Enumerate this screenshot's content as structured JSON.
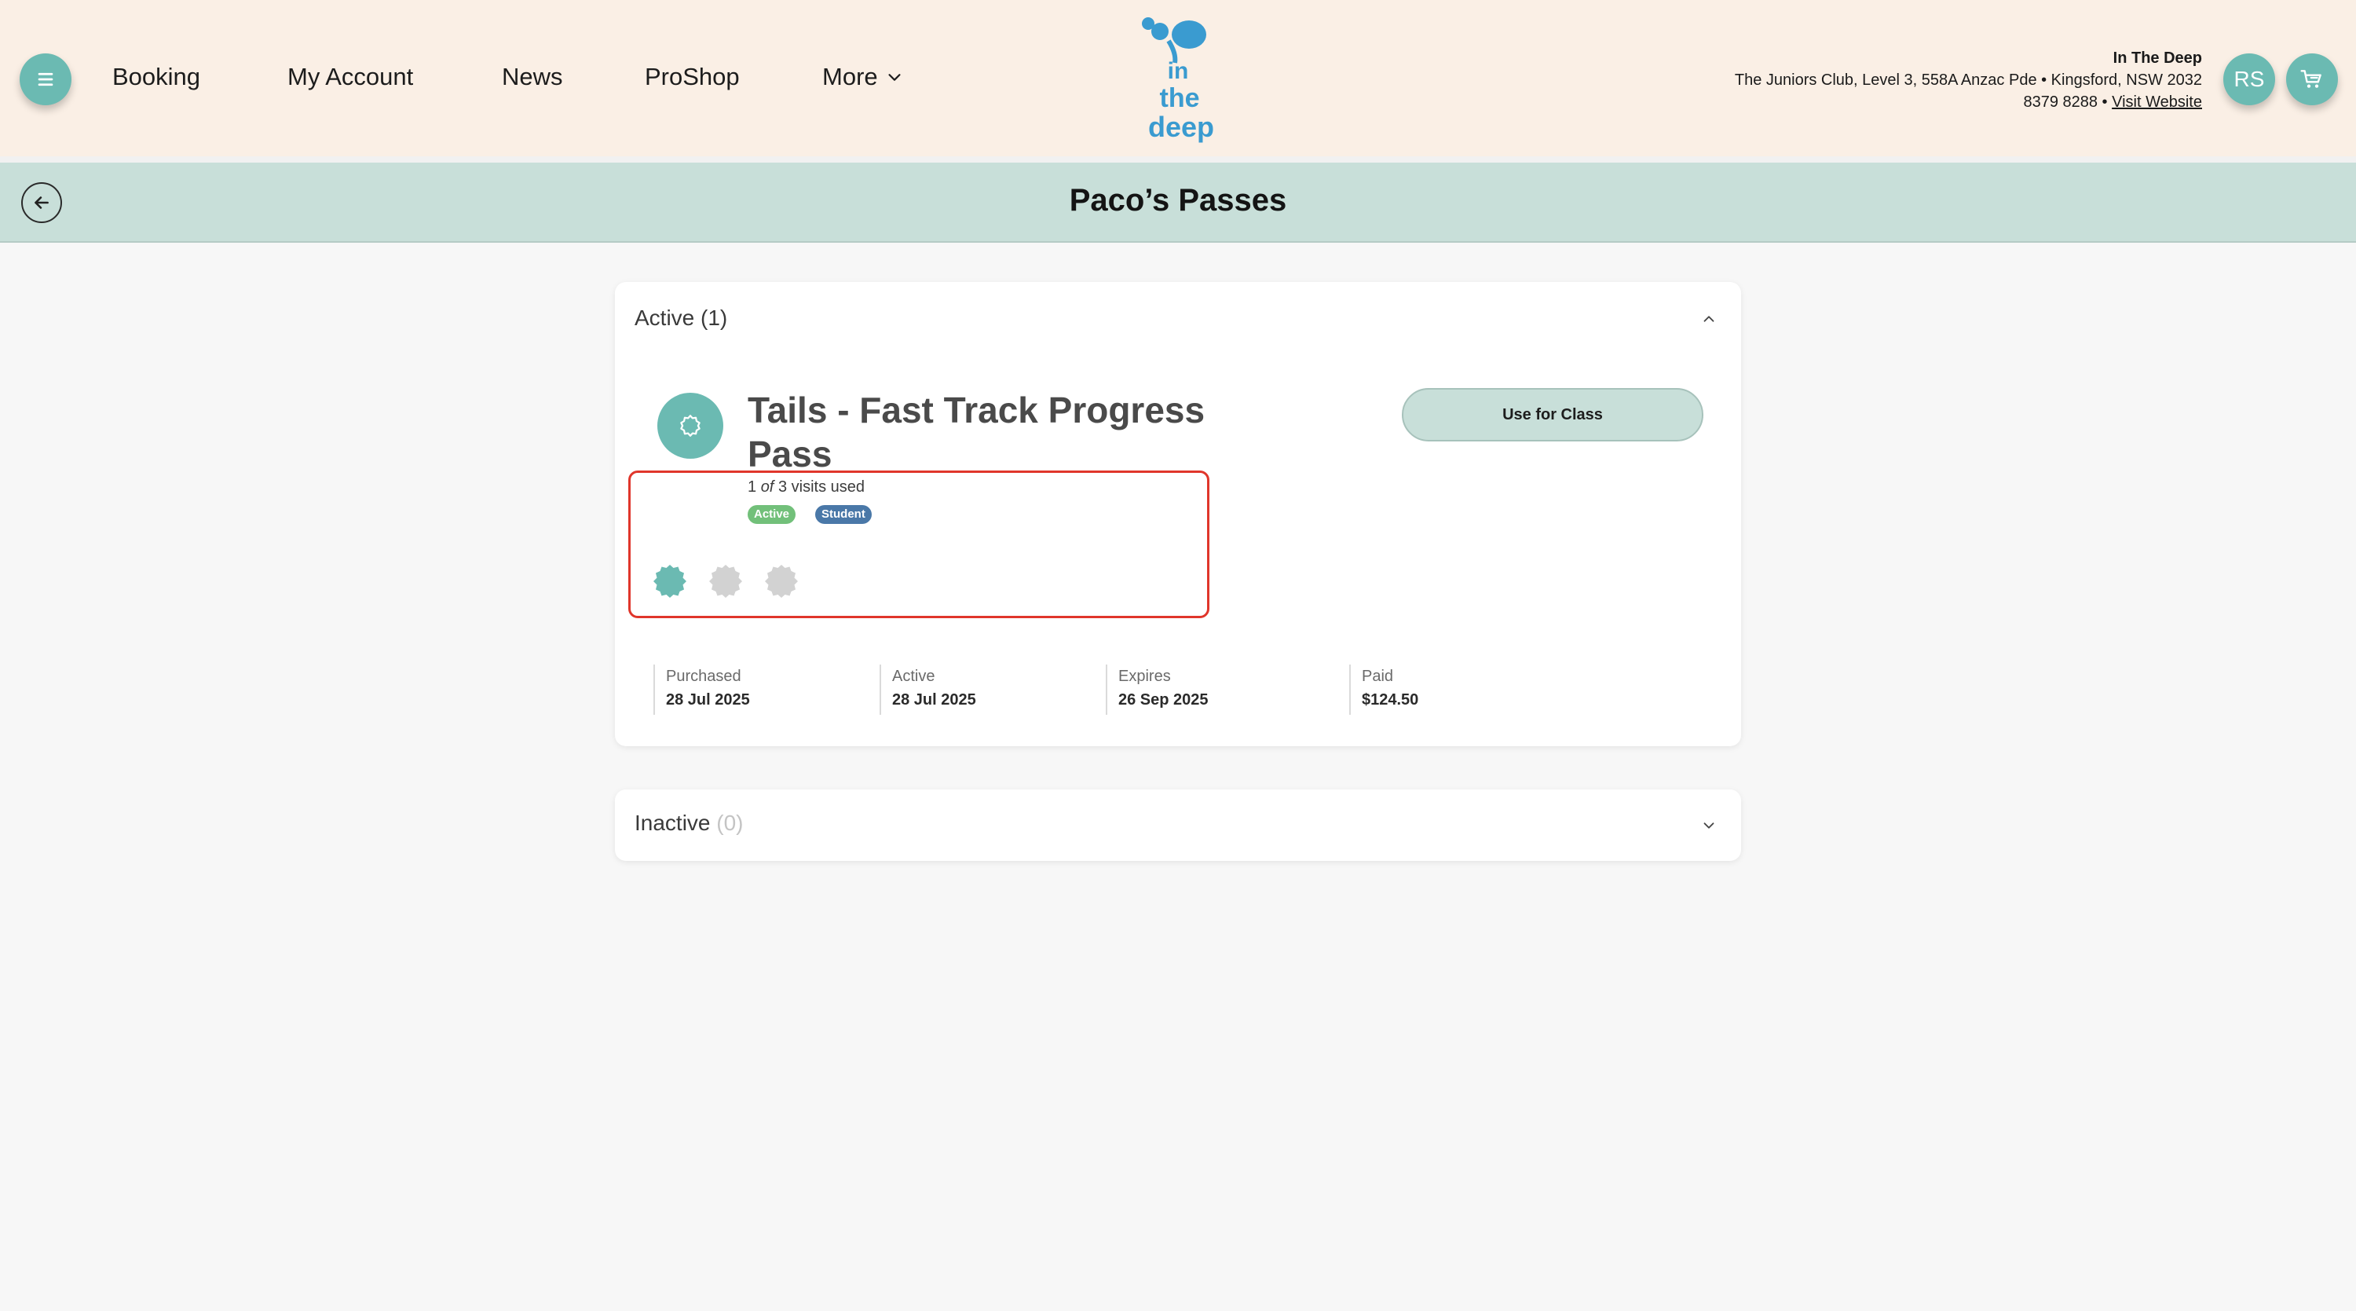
{
  "header": {
    "nav": [
      "Booking",
      "My Account",
      "News",
      "ProShop",
      "More"
    ],
    "logo_text": [
      "in",
      "the",
      "deep"
    ],
    "club": {
      "name": "In The Deep",
      "address": "The Juniors Club, Level 3, 558A Anzac Pde • Kingsford, NSW 2032",
      "phone": "8379 8288 •",
      "website_link": "Visit Website"
    },
    "avatar_initials": "RS"
  },
  "page": {
    "title": "Paco’s Passes"
  },
  "active_section": {
    "label": "Active",
    "count": "(1)",
    "pass": {
      "title": "Tails - Fast Track Progress Pass",
      "visits_used": "1",
      "visits_of": "of",
      "visits_total": "3",
      "visits_suffix": "visits used",
      "badges": [
        "Active",
        "Student"
      ],
      "visit_dots_filled": 1,
      "visit_dots_total": 3,
      "use_button": "Use for Class",
      "details": [
        {
          "label": "Purchased",
          "value": "28 Jul 2025"
        },
        {
          "label": "Active",
          "value": "28 Jul 2025"
        },
        {
          "label": "Expires",
          "value": "26 Sep 2025"
        },
        {
          "label": "Paid",
          "value": "$124.50"
        }
      ]
    }
  },
  "inactive_section": {
    "label": "Inactive",
    "count": "(0)"
  },
  "colors": {
    "header_bg": "#faefe5",
    "accent_teal": "#6bbab2",
    "titlebar_bg": "#c8dfd9",
    "badge_active": "#72c07a",
    "badge_student": "#4a78a8",
    "highlight_red": "#e0362b",
    "logo_blue": "#3a9bd0"
  },
  "icons": {
    "menu": "hamburger-icon",
    "cart": "cart-icon",
    "back": "arrow-left-icon",
    "more": "chevron-down-icon",
    "pass": "gear-icon",
    "collapse": "chevron-up-icon",
    "expand": "chevron-down-icon"
  }
}
